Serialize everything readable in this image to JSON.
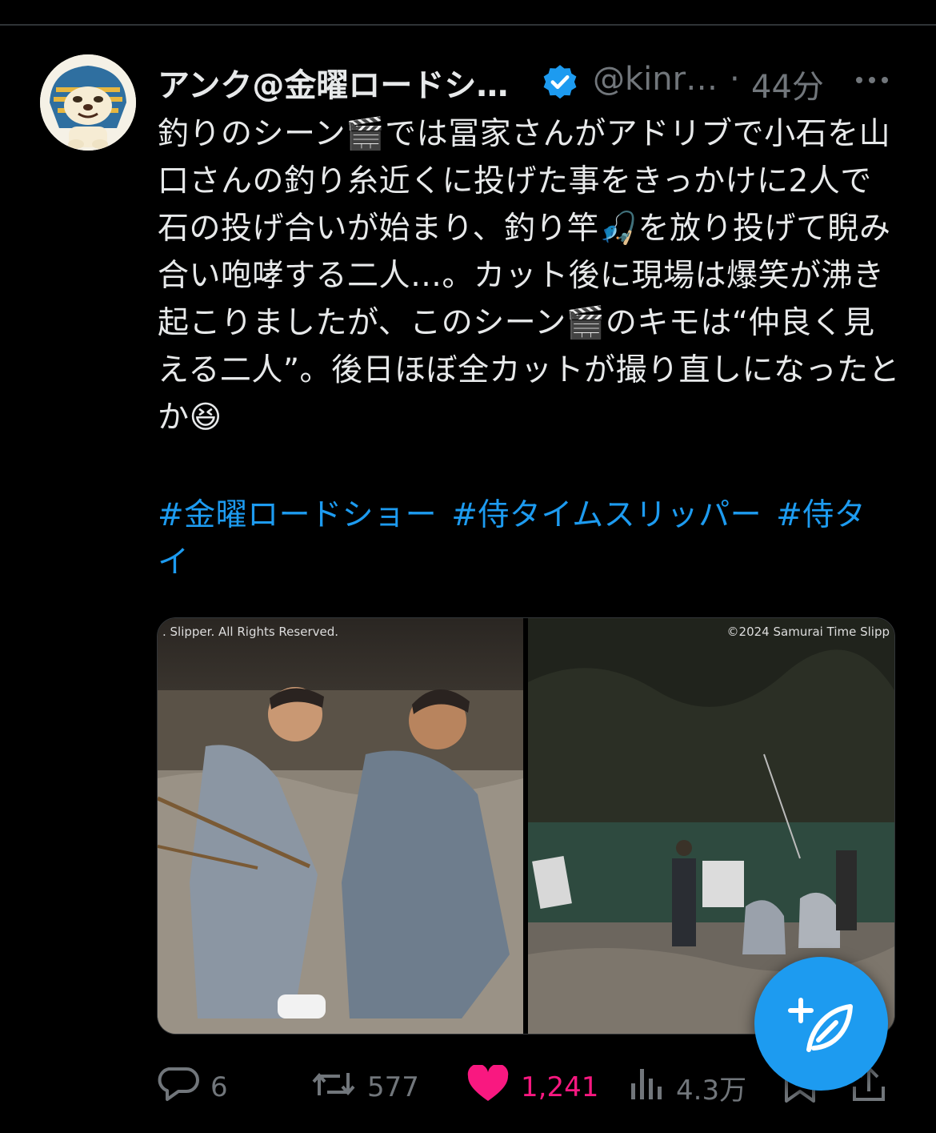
{
  "tweet": {
    "display_name": "アンク@金曜ロードシ…",
    "handle": "@kinr…",
    "separator": "·",
    "time": "44分",
    "text": "釣りのシーン🎬では冨家さんがアドリブで小石を山口さんの釣り糸近くに投げた事をきっかけに2人で石の投げ合いが始まり、釣り竿🎣を放り投げて睨み合い咆哮する二人…。カット後に現場は爆笑が沸き起こりましたが、このシーン🎬のキモは“仲良く見える二人”。後日ほぼ全カットが撮り直しになったとか😆",
    "hashtags": [
      "#金曜ロードショー",
      "#侍タイムスリッパー",
      "#侍タイ"
    ],
    "media": {
      "left_credit": ". Slipper. All Rights Reserved.",
      "right_credit": "©2024 Samurai Time Slipp"
    }
  },
  "actions": {
    "replies": "6",
    "retweets": "577",
    "likes": "1,241",
    "views": "4.3万"
  },
  "colors": {
    "background": "#000000",
    "text": "#e7e9ea",
    "muted": "#71767b",
    "accent": "#1d9bf0",
    "like": "#f91880"
  },
  "icons": [
    "more-icon",
    "verified-icon",
    "reply-icon",
    "retweet-icon",
    "like-icon",
    "views-icon",
    "bookmark-icon",
    "share-icon",
    "compose-icon"
  ]
}
